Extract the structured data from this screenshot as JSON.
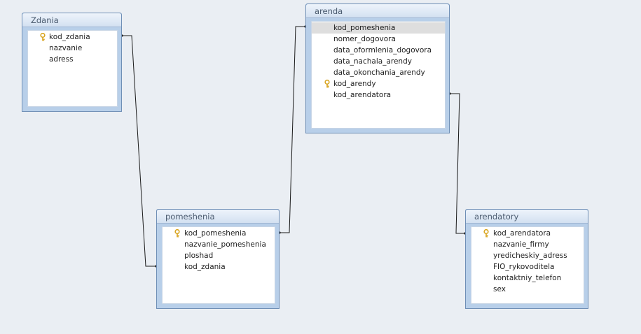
{
  "colors": {
    "canvas": "#eaeef3",
    "table_frame": "#b8cfe9",
    "selected_row": "#dedede",
    "key_icon": "#d9a520",
    "relation_line": "#1a1a1a"
  },
  "tables": {
    "zdania": {
      "title": "Zdania",
      "fields": [
        {
          "label": "kod_zdania",
          "key": true
        },
        {
          "label": "nazvanie",
          "key": false
        },
        {
          "label": "adress",
          "key": false
        }
      ]
    },
    "arenda": {
      "title": "arenda",
      "fields": [
        {
          "label": "kod_pomeshenia",
          "key": false,
          "selected": true
        },
        {
          "label": "nomer_dogovora",
          "key": false
        },
        {
          "label": "data_oformlenia_dogovora",
          "key": false
        },
        {
          "label": "data_nachala_arendy",
          "key": false
        },
        {
          "label": "data_okonchania_arendy",
          "key": false
        },
        {
          "label": "kod_arendy",
          "key": true
        },
        {
          "label": "kod_arendatora",
          "key": false
        }
      ]
    },
    "pomeshenia": {
      "title": "pomeshenia",
      "fields": [
        {
          "label": "kod_pomeshenia",
          "key": true
        },
        {
          "label": "nazvanie_pomeshenia",
          "key": false
        },
        {
          "label": "ploshad",
          "key": false
        },
        {
          "label": "kod_zdania",
          "key": false
        }
      ]
    },
    "arendatory": {
      "title": "arendatory",
      "fields": [
        {
          "label": "kod_arendatora",
          "key": true
        },
        {
          "label": "nazvanie_firmy",
          "key": false
        },
        {
          "label": "yredicheskiy_adress",
          "key": false
        },
        {
          "label": "FIO_rykovoditela",
          "key": false
        },
        {
          "label": "kontaktniy_telefon",
          "key": false
        },
        {
          "label": "sex",
          "key": false
        }
      ]
    }
  },
  "relationships": [
    {
      "from": "zdania.kod_zdania",
      "to": "pomeshenia.kod_zdania"
    },
    {
      "from": "pomeshenia.kod_pomeshenia",
      "to": "arenda.kod_pomeshenia"
    },
    {
      "from": "arenda.kod_arendatora",
      "to": "arendatory.kod_arendatora"
    }
  ]
}
